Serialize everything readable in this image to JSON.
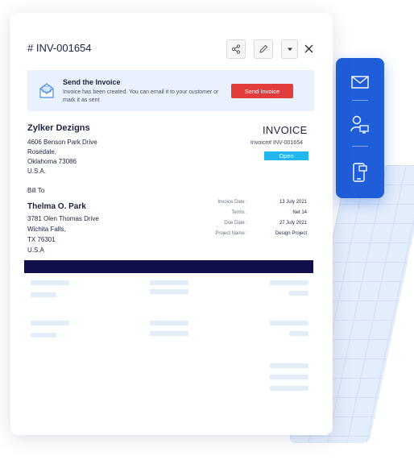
{
  "invoice": {
    "number_heading": "# INV-001654",
    "banner": {
      "title": "Send the Invoice",
      "text": "Invoice has been created. You can email it to your customer or mark it as sent",
      "button": "Send Invoice"
    },
    "company": {
      "name": "Zylker Dezigns",
      "address": [
        "4606 Benson Park Drive",
        "Rosedale,",
        "Oklahoma 73086",
        "U.S.A."
      ]
    },
    "doc_title": "INVOICE",
    "doc_number_line": "Invoice# INV-001654",
    "status": "Open",
    "bill_to_label": "Bill To",
    "client": {
      "name": "Thelma O. Park",
      "address": [
        "3781 Olen Thomas Drive",
        "Wichita Falls,",
        "TX 76301",
        "U.S.A"
      ]
    },
    "meta": [
      {
        "label": "Invoice Date :",
        "value": "13 July 2021"
      },
      {
        "label": "Terms :",
        "value": "Net 14"
      },
      {
        "label": "Due Date :",
        "value": "27 July 2021"
      },
      {
        "label": "Project Name :",
        "value": "Design Project"
      }
    ]
  },
  "icons": {
    "share": "share-icon",
    "edit": "pencil-icon",
    "more": "caret-down-icon",
    "close": "close-icon",
    "banner": "envelope-icon",
    "side": [
      "mail-icon",
      "user-device-icon",
      "mobile-icon"
    ]
  },
  "colors": {
    "accent_blue": "#1f5ed8",
    "send_button": "#e23c3c",
    "status_open": "#22b5ee",
    "table_header": "#12104a"
  }
}
